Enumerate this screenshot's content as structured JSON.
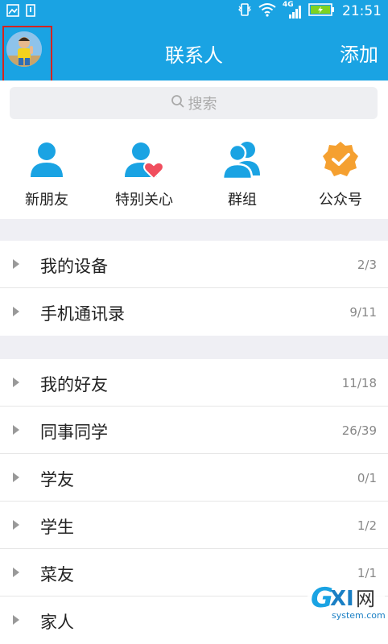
{
  "status_bar": {
    "time": "21:51",
    "network_label": "4G"
  },
  "header": {
    "title": "联系人",
    "add_label": "添加"
  },
  "search": {
    "placeholder": "搜索"
  },
  "quick_entries": [
    {
      "label": "新朋友",
      "icon": "person-icon"
    },
    {
      "label": "特别关心",
      "icon": "person-heart-icon"
    },
    {
      "label": "群组",
      "icon": "group-icon"
    },
    {
      "label": "公众号",
      "icon": "verified-badge-icon"
    }
  ],
  "groups_top": [
    {
      "label": "我的设备",
      "count": "2/3"
    },
    {
      "label": "手机通讯录",
      "count": "9/11"
    }
  ],
  "groups_friends": [
    {
      "label": "我的好友",
      "count": "11/18"
    },
    {
      "label": "同事同学",
      "count": "26/39"
    },
    {
      "label": "学友",
      "count": "0/1"
    },
    {
      "label": "学生",
      "count": "1/2"
    },
    {
      "label": "菜友",
      "count": "1/1"
    },
    {
      "label": "家人",
      "count": ""
    }
  ],
  "watermark": {
    "text": "GXI网",
    "sub": "system.com"
  },
  "colors": {
    "brand_blue": "#1aa3e3",
    "highlight_red": "#d6231e",
    "badge_orange": "#f5a030",
    "heart_red": "#f04e5e"
  }
}
